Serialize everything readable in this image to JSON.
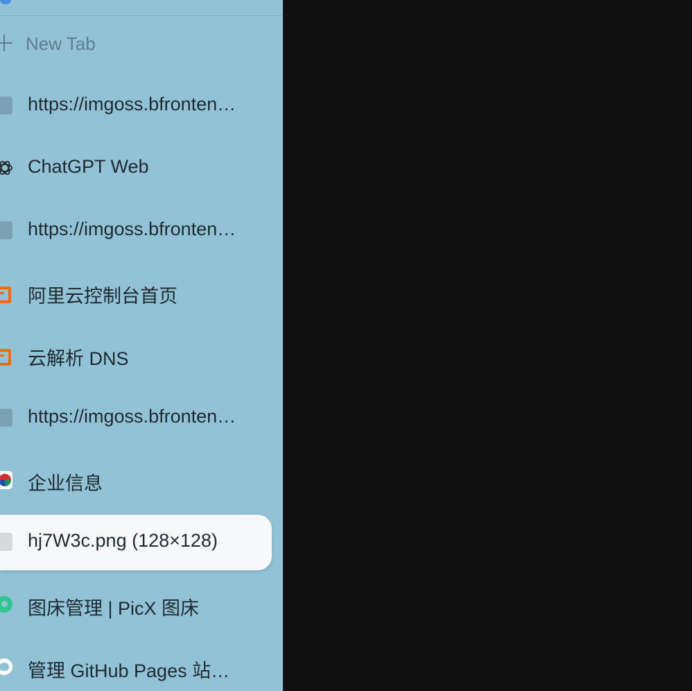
{
  "sidebar": {
    "new_tab_label": "New Tab",
    "tabs": [
      {
        "label": "https://imgoss.bfronten…",
        "icon": "generic-page-icon"
      },
      {
        "label": "ChatGPT Web",
        "icon": "chatgpt-icon"
      },
      {
        "label": "https://imgoss.bfronten…",
        "icon": "generic-page-icon"
      },
      {
        "label": "阿里云控制台首页",
        "icon": "aliyun-icon"
      },
      {
        "label": "云解析 DNS",
        "icon": "aliyun-icon"
      },
      {
        "label": "https://imgoss.bfronten…",
        "icon": "generic-page-icon"
      },
      {
        "label": "企业信息",
        "icon": "qiye-logo-icon"
      },
      {
        "label": "hj7W3c.png (128×128)",
        "icon": "image-file-icon",
        "active": true
      },
      {
        "label": "图床管理 | PicX 图床",
        "icon": "picx-icon"
      },
      {
        "label": "管理 GitHub Pages 站…",
        "icon": "github-icon"
      }
    ]
  },
  "colors": {
    "sidebar_bg": "#92c2d6",
    "content_bg": "#101010",
    "active_tab_bg": "#f7f8fa",
    "aliyun_orange": "#ff6a00"
  }
}
